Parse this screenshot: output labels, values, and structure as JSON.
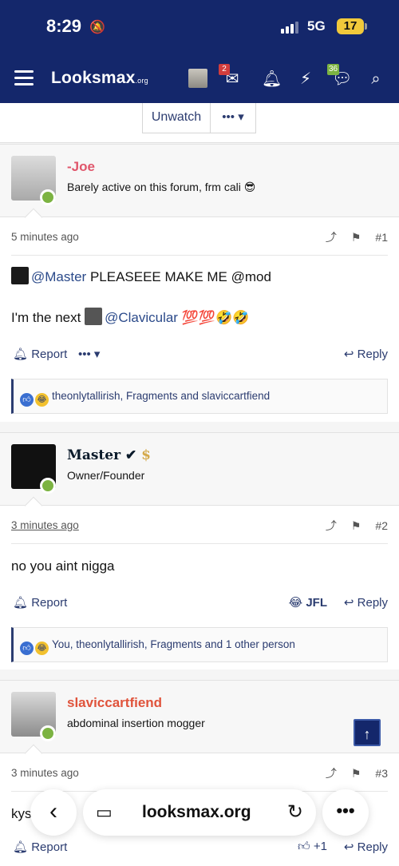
{
  "status_bar": {
    "time": "8:29",
    "network": "5G",
    "battery": "17"
  },
  "navbar": {
    "logo": "Looksmax",
    "logo_suffix": ".org",
    "inbox_badge": "2",
    "alerts_badge": "36"
  },
  "thread_controls": {
    "unwatch_label": "Unwatch",
    "more_label": "•••"
  },
  "posts": [
    {
      "author": "-Joe",
      "author_color": "#e0566b",
      "title": "Barely active on this forum, frm cali 😎",
      "time": "5 minutes ago",
      "number": "#1",
      "line1_mention1": "@Master",
      "line1_text": " PLEASEEE MAKE ME @mod",
      "line2_text": "I'm the next ",
      "line2_mention": "@Clavicular",
      "line2_emoji": " 💯💯🤣🤣",
      "report": "Report",
      "reply": "Reply",
      "reactions": "theonlytallirish, Fragments and slaviccartfiend"
    },
    {
      "author": "Master",
      "author_badge": "$",
      "title": "Owner/Founder",
      "time": "3 minutes ago",
      "number": "#2",
      "text": "no you aint nigga",
      "report": "Report",
      "jfl": "JFL",
      "reply": "Reply",
      "reactions": "You, theonlytallirish, Fragments and 1 other person"
    },
    {
      "author": "slaviccartfiend",
      "author_color": "#e0533b",
      "title": "abdominal insertion mogger",
      "time": "3 minutes ago",
      "number": "#3",
      "text": "kys",
      "report": "Report",
      "plus": "+1",
      "reply": "Reply"
    }
  ],
  "browser": {
    "url": "looksmax.org"
  }
}
